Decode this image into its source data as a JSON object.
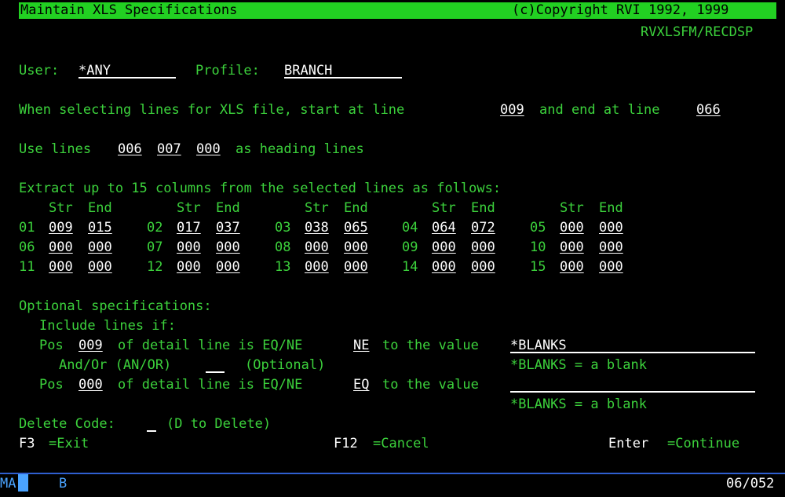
{
  "title": "Maintain XLS Specifications",
  "copyright": "(c)Copyright RVI 1992, 1999",
  "program_id": "RVXLSFM/RECDSP",
  "user_label": "User:",
  "user_value": "*ANY",
  "profile_label": "Profile:",
  "profile_value": "BRANCH",
  "select_prefix": "When selecting lines for XLS file, start at line",
  "start_line": "009",
  "select_mid": "and end at line",
  "end_line": "066",
  "heading_prefix": "Use lines",
  "heading_lines": [
    "006",
    "007",
    "000"
  ],
  "heading_suffix": "as heading lines",
  "extract_text": "Extract up to 15 columns from the selected lines as follows:",
  "str_header": "Str",
  "end_header": "End",
  "columns": [
    {
      "num": "01",
      "str": "009",
      "end": "015"
    },
    {
      "num": "02",
      "str": "017",
      "end": "037"
    },
    {
      "num": "03",
      "str": "038",
      "end": "065"
    },
    {
      "num": "04",
      "str": "064",
      "end": "072"
    },
    {
      "num": "05",
      "str": "000",
      "end": "000"
    },
    {
      "num": "06",
      "str": "000",
      "end": "000"
    },
    {
      "num": "07",
      "str": "000",
      "end": "000"
    },
    {
      "num": "08",
      "str": "000",
      "end": "000"
    },
    {
      "num": "09",
      "str": "000",
      "end": "000"
    },
    {
      "num": "10",
      "str": "000",
      "end": "000"
    },
    {
      "num": "11",
      "str": "000",
      "end": "000"
    },
    {
      "num": "12",
      "str": "000",
      "end": "000"
    },
    {
      "num": "13",
      "str": "000",
      "end": "000"
    },
    {
      "num": "14",
      "str": "000",
      "end": "000"
    },
    {
      "num": "15",
      "str": "000",
      "end": "000"
    }
  ],
  "optional_label": "Optional specifications:",
  "include_label": "Include lines if:",
  "pos_label": "Pos",
  "detail_text": "of detail line is EQ/NE",
  "to_value_text": "to the value",
  "cond1": {
    "pos": "009",
    "op": "NE",
    "value": "*BLANKS"
  },
  "andor_label": "And/Or (AN/OR)",
  "andor_value": "",
  "optional_text": "(Optional)",
  "blanks_note": "*BLANKS = a blank",
  "cond2": {
    "pos": "000",
    "op": "EQ",
    "value": ""
  },
  "delete_label": "Delete Code:",
  "delete_value": "",
  "delete_hint": "(D to Delete)",
  "f3_key": "F3",
  "f3_label": "=Exit",
  "f12_key": "F12",
  "f12_label": "=Cancel",
  "enter_key": "Enter",
  "enter_label": "=Continue",
  "status_left": "MA",
  "status_mid": "B",
  "status_right": "06/052"
}
